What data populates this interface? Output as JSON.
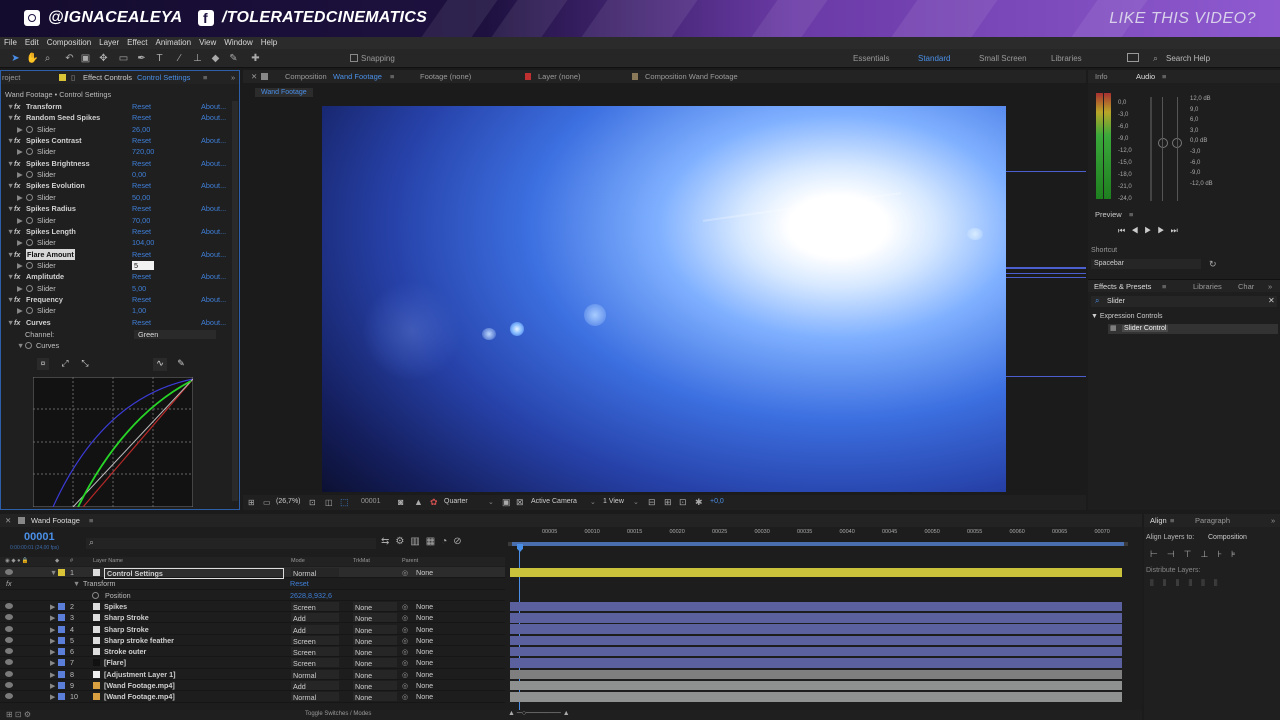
{
  "banner": {
    "instagram": "@IGNACEALEYA",
    "facebook": "/TOLERATEDCINEMATICS",
    "cta": "LIKE THIS VIDEO?"
  },
  "menu": [
    "File",
    "Edit",
    "Composition",
    "Layer",
    "Effect",
    "Animation",
    "View",
    "Window",
    "Help"
  ],
  "toolbar": {
    "snapping": "Snapping",
    "workspaces": [
      "Essentials",
      "Standard",
      "Small Screen",
      "Libraries"
    ],
    "active": "Standard",
    "search": "Search Help"
  },
  "effect_panel": {
    "tab_project": "roject",
    "tab_label": "Effect Controls",
    "tab_layer": "Control Settings",
    "breadcrumb": "Wand Footage • Control Settings",
    "rows": [
      {
        "type": "fx",
        "name": "Transform",
        "reset": "Reset",
        "about": "About..."
      },
      {
        "type": "fx",
        "name": "Random Seed Spikes",
        "reset": "Reset",
        "about": "About..."
      },
      {
        "type": "slider",
        "name": "Slider",
        "value": "26,00"
      },
      {
        "type": "fx",
        "name": "Spikes Contrast",
        "reset": "Reset",
        "about": "About..."
      },
      {
        "type": "slider",
        "name": "Slider",
        "value": "720,00"
      },
      {
        "type": "fx",
        "name": "Spikes Brightness",
        "reset": "Reset",
        "about": "About..."
      },
      {
        "type": "slider",
        "name": "Slider",
        "value": "0,00"
      },
      {
        "type": "fx",
        "name": "Spikes Evolution",
        "reset": "Reset",
        "about": "About..."
      },
      {
        "type": "slider",
        "name": "Slider",
        "value": "50,00"
      },
      {
        "type": "fx",
        "name": "Spikes Radius",
        "reset": "Reset",
        "about": "About..."
      },
      {
        "type": "slider",
        "name": "Slider",
        "value": "70,00"
      },
      {
        "type": "fx",
        "name": "Spikes Length",
        "reset": "Reset",
        "about": "About..."
      },
      {
        "type": "slider",
        "name": "Slider",
        "value": "104,00"
      },
      {
        "type": "fx",
        "name": "Flare Amount",
        "reset": "Reset",
        "about": "About..."
      },
      {
        "type": "slider",
        "name": "Slider",
        "value": "5"
      },
      {
        "type": "fx",
        "name": "Amplitutde",
        "reset": "Reset",
        "about": "About..."
      },
      {
        "type": "slider",
        "name": "Slider",
        "value": "5,00"
      },
      {
        "type": "fx",
        "name": "Frequency",
        "reset": "Reset",
        "about": "About..."
      },
      {
        "type": "slider",
        "name": "Slider",
        "value": "1,00"
      },
      {
        "type": "fx",
        "name": "Curves",
        "reset": "Reset",
        "about": "About..."
      }
    ],
    "channel_label": "Channel:",
    "channel_value": "Green",
    "curves_label": "Curves"
  },
  "comp_panel": {
    "tab1_prefix": "Composition",
    "tab1_name": "Wand Footage",
    "tab2": "Footage (none)",
    "tab3": "Layer (none)",
    "tab4": "Composition Wand Footage",
    "sub_tab": "Wand Footage",
    "zoom": "(26,7%)",
    "timecode": "00001",
    "resolution": "Quarter",
    "camera": "Active Camera",
    "views": "1 View",
    "exposure": "+0,0"
  },
  "right_panel": {
    "info": "Info",
    "audio": "Audio",
    "audio_left": [
      "0,0",
      "-3,0",
      "-6,0",
      "-9,0",
      "-12,0",
      "-15,0",
      "-18,0",
      "-21,0",
      "-24,0"
    ],
    "audio_right": [
      "12,0 dB",
      "9,0",
      "6,0",
      "3,0",
      "0,0 dB",
      "-3,0",
      "-6,0",
      "-9,0",
      "-12,0 dB"
    ],
    "preview": "Preview",
    "shortcut_label": "Shortcut",
    "shortcut": "Spacebar",
    "effects_presets": "Effects & Presets",
    "libraries": "Libraries",
    "char": "Char",
    "search": "Slider",
    "category": "Expression Controls",
    "result": "Slider Control"
  },
  "timeline": {
    "comp_name": "Wand Footage",
    "timecode": "00001",
    "timecode_sub": "0:00:00:01 (24,00 fps)",
    "headers": {
      "layer_name": "Layer Name",
      "mode": "Mode",
      "trkmat": "TrkMat",
      "parent": "Parent"
    },
    "ticks": [
      "00005",
      "00010",
      "00015",
      "00020",
      "00025",
      "00030",
      "00035",
      "00040",
      "00045",
      "00050",
      "00055",
      "00060",
      "00065",
      "00070"
    ],
    "layers": [
      {
        "num": "1",
        "name": "Control Settings",
        "mode": "Normal",
        "trkmat": "",
        "parent": "None",
        "color": "#d8c436",
        "bar": "#c9c23a",
        "selected": true
      },
      {
        "num": "2",
        "name": "Spikes",
        "mode": "Screen",
        "trkmat": "None",
        "parent": "None",
        "color": "#5b7fd9",
        "bar": "#5b609f"
      },
      {
        "num": "3",
        "name": "Sharp Stroke",
        "mode": "Add",
        "trkmat": "None",
        "parent": "None",
        "color": "#5b7fd9",
        "bar": "#5b609f"
      },
      {
        "num": "4",
        "name": "Sharp Stroke",
        "mode": "Add",
        "trkmat": "None",
        "parent": "None",
        "color": "#5b7fd9",
        "bar": "#5b609f"
      },
      {
        "num": "5",
        "name": "Sharp stroke feather",
        "mode": "Screen",
        "trkmat": "None",
        "parent": "None",
        "color": "#5b7fd9",
        "bar": "#5b609f"
      },
      {
        "num": "6",
        "name": "Stroke outer",
        "mode": "Screen",
        "trkmat": "None",
        "parent": "None",
        "color": "#5b7fd9",
        "bar": "#5b609f"
      },
      {
        "num": "7",
        "name": "[Flare]",
        "mode": "Screen",
        "trkmat": "None",
        "parent": "None",
        "color": "#5b7fd9",
        "bar": "#5b609f"
      },
      {
        "num": "8",
        "name": "[Adjustment Layer 1]",
        "mode": "Normal",
        "trkmat": "None",
        "parent": "None",
        "color": "#5b7fd9",
        "bar": "#7f7f7f"
      },
      {
        "num": "9",
        "name": "[Wand Footage.mp4]",
        "mode": "Add",
        "trkmat": "None",
        "parent": "None",
        "color": "#5b7fd9",
        "bar": "#8f9090"
      },
      {
        "num": "10",
        "name": "[Wand Footage.mp4]",
        "mode": "Normal",
        "trkmat": "None",
        "parent": "None",
        "color": "#5b7fd9",
        "bar": "#8f9090"
      }
    ],
    "transform_label": "Transform",
    "transform_reset": "Reset",
    "position_label": "Position",
    "position_value": "2628,8,932,6",
    "toggle": "Toggle Switches / Modes"
  },
  "align_panel": {
    "tab1": "Align",
    "tab2": "Paragraph",
    "align_to_label": "Align Layers to:",
    "align_to": "Composition",
    "distribute": "Distribute Layers:"
  }
}
